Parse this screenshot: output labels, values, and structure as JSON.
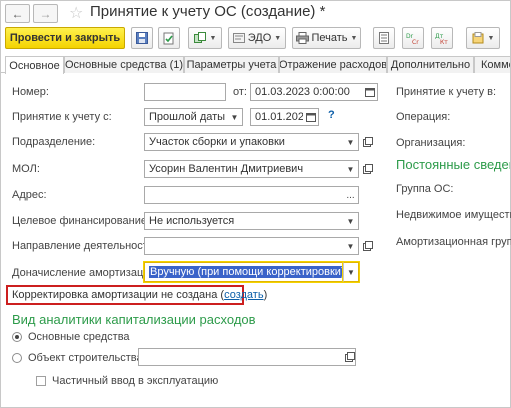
{
  "window": {
    "title": "Принятие к учету ОС (создание) *",
    "back_icon": "arrow-left-icon",
    "forward_icon": "arrow-right-icon",
    "favorite_icon": "star-icon"
  },
  "toolbar": {
    "post_close_label": "Провести и закрыть",
    "edo_label": "ЭДО",
    "print_label": "Печать"
  },
  "tabs": [
    {
      "label": "Основное",
      "active": true
    },
    {
      "label": "Основные средства (1)",
      "active": false
    },
    {
      "label": "Параметры учета",
      "active": false
    },
    {
      "label": "Отражение расходов",
      "active": false
    },
    {
      "label": "Дополнительно",
      "active": false
    },
    {
      "label": "Комме",
      "active": false
    }
  ],
  "form": {
    "number_label": "Номер:",
    "number_value": "",
    "from_label": "от:",
    "date_value": "01.03.2023  0:00:00",
    "accept_label": "Принятие к учету с:",
    "accept_mode": "Прошлой даты",
    "accept_date": "01.01.2023",
    "help_mark": "?",
    "division_label": "Подразделение:",
    "division_value": "Участок сборки и упаковки",
    "mol_label": "МОЛ:",
    "mol_value": "Усорин Валентин Дмитриевич",
    "address_label": "Адрес:",
    "address_value": "",
    "address_btn": "...",
    "financing_label": "Целевое финансирование:",
    "financing_value": "Не используется",
    "direction_label": "Направление деятельности:",
    "direction_value": "",
    "depreciation_label": "Доначисление амортизации:",
    "depreciation_value": "Вручную (при помощи корректировки)",
    "correction_text": "Корректировка амортизации не создана (",
    "correction_link": "создать",
    "correction_close": ")",
    "capital_section": "Вид аналитики капитализации расходов",
    "radio_fixed_assets": "Основные средства",
    "radio_construction": "Объект строительства:",
    "construction_value": "",
    "partial_checkbox": "Частичный ввод в эксплуатацию"
  },
  "right_panel": {
    "accept_label": "Принятие к учету в:",
    "operation_label": "Операция:",
    "organization_label": "Организация:",
    "section_title": "Постоянные сведения",
    "group_label": "Группа ОС:",
    "realty_label": "Недвижимое имущество:",
    "depreciation_group_label": "Амортизационная группа:"
  },
  "colors": {
    "accent_yellow": "#f4d300",
    "section_green": "#2d9b4a",
    "link_blue": "#0b5ea8",
    "highlight_border": "#cc1f1f",
    "selection_blue": "#3a63c9"
  }
}
